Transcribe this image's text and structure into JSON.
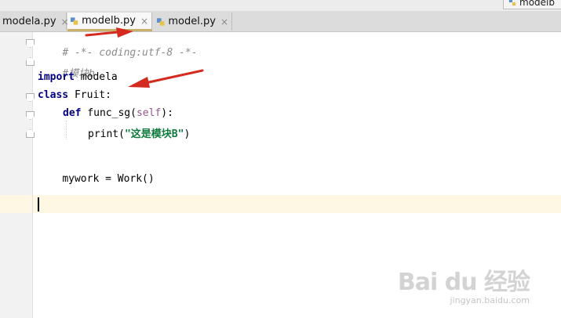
{
  "run_config": {
    "label": "modelb"
  },
  "tabs": [
    {
      "label": "modela.py",
      "active": false
    },
    {
      "label": "modelb.py",
      "active": true
    },
    {
      "label": "model.py",
      "active": false
    }
  ],
  "close_glyph": "×",
  "code": {
    "line1": "# -*- coding:utf-8 -*-",
    "line2": "#模块b",
    "line3_kw": "import",
    "line3_rest": " modela",
    "line4_kw": "class",
    "line4_rest": " Fruit:",
    "line5_kw": "def",
    "line5_name": " func_sg(",
    "line5_self": "self",
    "line5_end": "):",
    "line6_start": "print(",
    "line6_str": "\"这是模块B\"",
    "line6_end": ")",
    "line8": "mywork = Work()"
  },
  "watermark": {
    "logo": "Bai du 经验",
    "url": "jingyan.baidu.com"
  },
  "colors": {
    "arrow": "#d42a1f",
    "keyword": "#000080",
    "string": "#0f7a3e",
    "caret_line": "#fdf7e3"
  }
}
